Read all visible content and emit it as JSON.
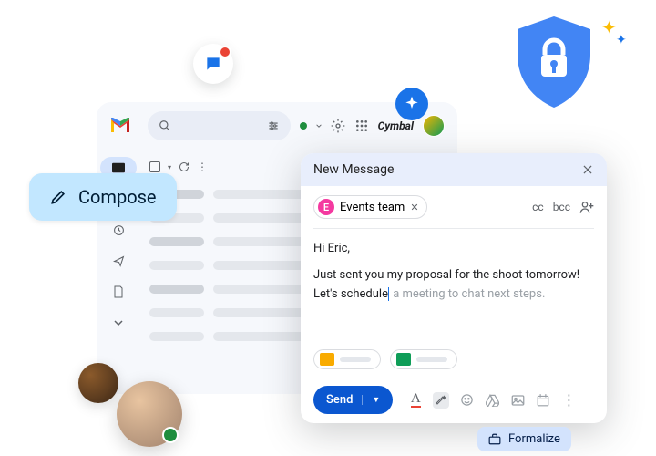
{
  "brand": "Cymbal",
  "compose_button": "Compose",
  "compose": {
    "title": "New Message",
    "recipient_chip": {
      "initial": "E",
      "name": "Events team"
    },
    "cc": "cc",
    "bcc": "bcc",
    "body_greeting": "Hi Eric,",
    "body_line1": "Just sent you my proposal for the shoot tomorrow!",
    "body_line2_typed": "Let's schedule",
    "body_line2_suggestion": " a meeting to chat next steps.",
    "send_label": "Send"
  },
  "formalize_label": "Formalize"
}
